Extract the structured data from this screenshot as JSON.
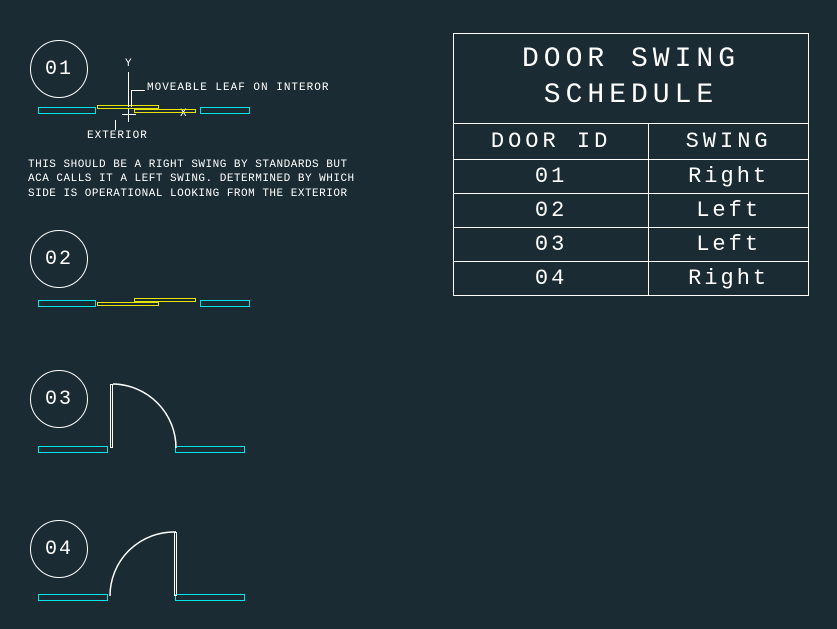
{
  "doors": [
    {
      "id": "01"
    },
    {
      "id": "02"
    },
    {
      "id": "03"
    },
    {
      "id": "04"
    }
  ],
  "annotations": {
    "y_label": "Y",
    "x_label": "X",
    "moveable_leaf": "MOVEABLE LEAF ON INTEROR",
    "exterior": "EXTERIOR",
    "note": "THIS SHOULD BE A RIGHT SWING BY STANDARDS BUT ACA CALLS IT A LEFT SWING. DETERMINED BY WHICH SIDE IS OPERATIONAL LOOKING FROM THE EXTERIOR"
  },
  "schedule": {
    "title": "DOOR SWING SCHEDULE",
    "headers": [
      "DOOR ID",
      "SWING"
    ],
    "rows": [
      {
        "id": "01",
        "swing": "Right"
      },
      {
        "id": "02",
        "swing": "Left"
      },
      {
        "id": "03",
        "swing": "Left"
      },
      {
        "id": "04",
        "swing": "Right"
      }
    ]
  }
}
